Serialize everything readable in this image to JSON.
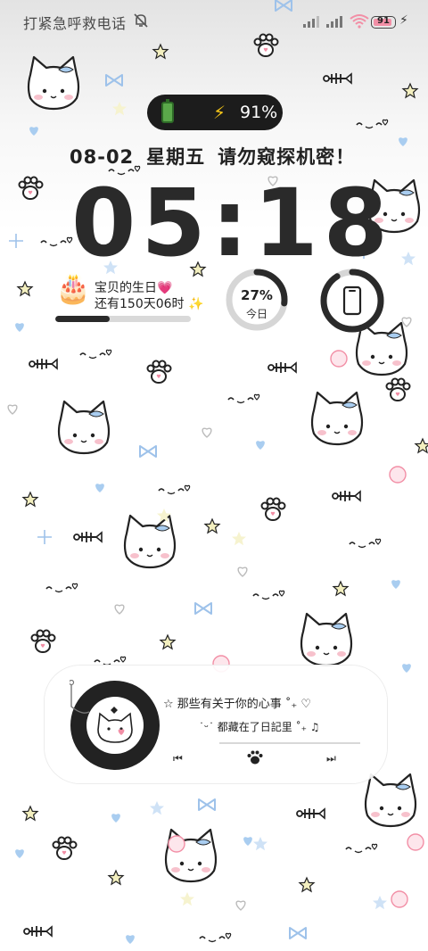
{
  "status_bar": {
    "emergency_text": "打紧急呼救电话",
    "battery_level": "91"
  },
  "battery_pill": {
    "percent": "91%"
  },
  "date_line": {
    "date": "08-02",
    "weekday": "星期五",
    "slogan": "请勿窥探机密！"
  },
  "clock": {
    "time": "05:18"
  },
  "birthday_widget": {
    "icon": "🎂",
    "title": "宝贝的生日💗",
    "countdown": "还有150天06时 ✨",
    "progress": 0.4
  },
  "day_progress": {
    "percent_text": "27%",
    "percent": 0.27,
    "label": "今日"
  },
  "phone_widget": {
    "icon": "phone-icon",
    "progress": 0.91
  },
  "music_card": {
    "line1": "☆ 那些有关于你的心事 ˚₊ ♡",
    "line2": "˙ᵕ˙ 都藏在了日記里 ˚₊ ♫",
    "prev_icon": "⏮",
    "next_icon": "⏭"
  },
  "colors": {
    "accent_dark": "#2a2a2a",
    "pill_bg": "#1c1c1c",
    "bolt": "#f5c518",
    "blue_heart": "#a9cdf0",
    "pink": "#f28fa6",
    "yellow_star": "#f3efbf"
  }
}
